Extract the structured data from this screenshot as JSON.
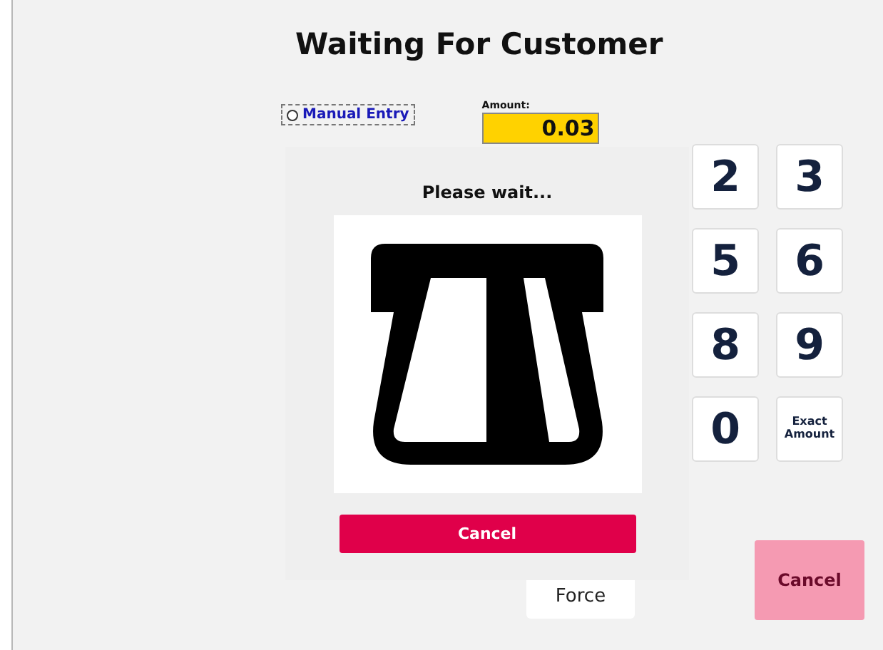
{
  "title": "Waiting For Customer",
  "manual_entry": {
    "label": "Manual Entry",
    "selected": false
  },
  "amount": {
    "label": "Amount:",
    "value": "0.03"
  },
  "keypad": [
    {
      "label": "2",
      "kind": "digit"
    },
    {
      "label": "3",
      "kind": "digit"
    },
    {
      "label": "5",
      "kind": "digit"
    },
    {
      "label": "6",
      "kind": "digit"
    },
    {
      "label": "8",
      "kind": "digit"
    },
    {
      "label": "9",
      "kind": "digit"
    },
    {
      "label": "0",
      "kind": "digit"
    },
    {
      "label": "Exact Amount",
      "kind": "text"
    }
  ],
  "force_button": "Force",
  "cancel_button": "Cancel",
  "dialog": {
    "message": "Please wait...",
    "cancel_button": "Cancel"
  }
}
